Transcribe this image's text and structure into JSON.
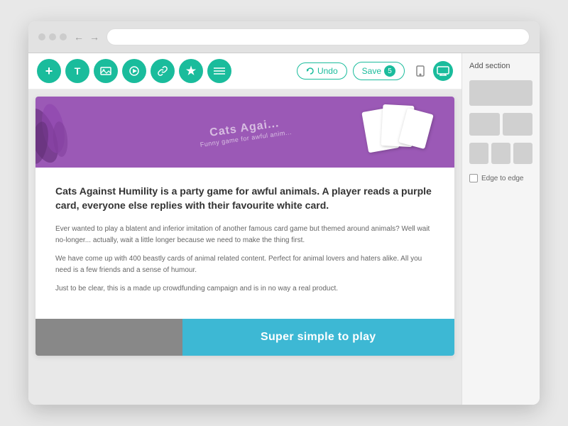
{
  "browser": {
    "addressbar_placeholder": ""
  },
  "toolbar": {
    "buttons": [
      {
        "id": "add",
        "icon": "+",
        "label": "add-element"
      },
      {
        "id": "text",
        "icon": "T",
        "label": "text-element"
      },
      {
        "id": "image",
        "icon": "🖼",
        "label": "image-element"
      },
      {
        "id": "video",
        "icon": "▶",
        "label": "video-element"
      },
      {
        "id": "link",
        "icon": "🔗",
        "label": "link-element"
      },
      {
        "id": "star",
        "icon": "★",
        "label": "star-element"
      },
      {
        "id": "settings",
        "icon": "≡",
        "label": "settings-element"
      }
    ],
    "undo_label": "Undo",
    "save_label": "Save",
    "save_count": "5",
    "device_mobile_icon": "📱",
    "device_desktop_icon": "🖥"
  },
  "hero": {
    "title_line1": "Cats Agai...",
    "title_line2": "Funny game for awful anim..."
  },
  "content": {
    "headline": "Cats Against Humility is a party game for awful animals. A player reads a purple card, everyone else replies with their favourite white card.",
    "paragraph1": "Ever wanted to play a blatent and inferior imitation of another famous card game but themed around animals? Well wait no-longer... actually, wait a little longer because we need to make the thing first.",
    "paragraph2": "We have come up with 400 beastly cards of animal related content. Perfect for animal lovers and haters alike. All you need is a few friends and a sense of humour.",
    "paragraph3": "Just to be clear, this is a made up crowdfunding campaign and is in no way a real product."
  },
  "cta": {
    "text": "Super simple to play"
  },
  "sidebar": {
    "add_section_label": "Add section",
    "edge_to_edge_label": "Edge to edge"
  }
}
